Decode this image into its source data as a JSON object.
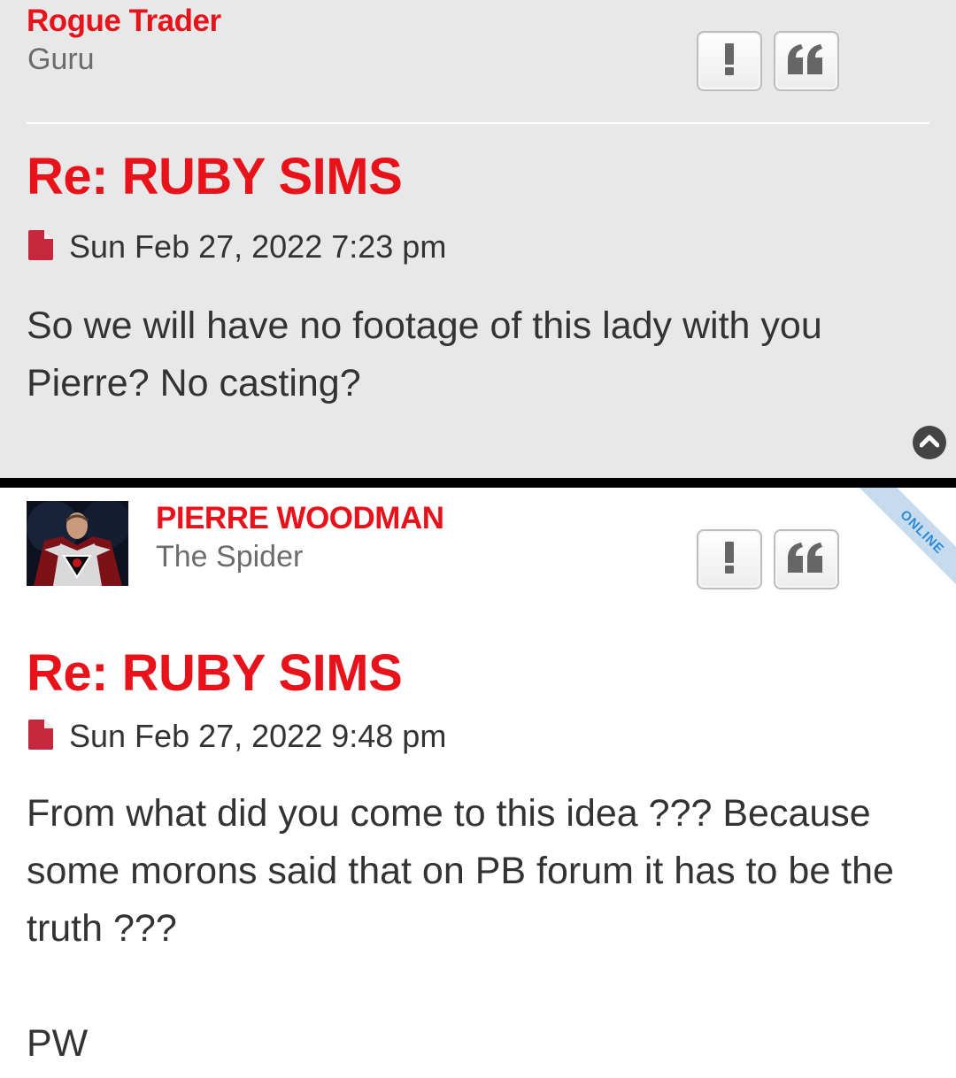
{
  "posts": [
    {
      "author": "Rogue Trader",
      "rank": "Guru",
      "report_icon": "exclamation-icon",
      "quote_icon": "quote-icon",
      "title": "Re: RUBY SIMS",
      "date": "Sun Feb 27, 2022 7:23 pm",
      "body": [
        "So we will have no footage of this lady with you Pierre? No casting?"
      ]
    },
    {
      "author": "PIERRE WOODMAN",
      "rank": "The Spider",
      "status": "ONLINE",
      "report_icon": "exclamation-icon",
      "quote_icon": "quote-icon",
      "title": "Re: RUBY SIMS",
      "date": "Sun Feb 27, 2022 9:48 pm",
      "body": [
        "From what did you come to this idea ??? Because some morons said that on PB forum it has to be the truth ???",
        "",
        "PW"
      ]
    }
  ],
  "colors": {
    "accent": "#e8121b",
    "text": "#333333",
    "rank": "#6c6c6c",
    "post_bg_alt": "#e8e8e8",
    "online": "#2b8ad6"
  }
}
